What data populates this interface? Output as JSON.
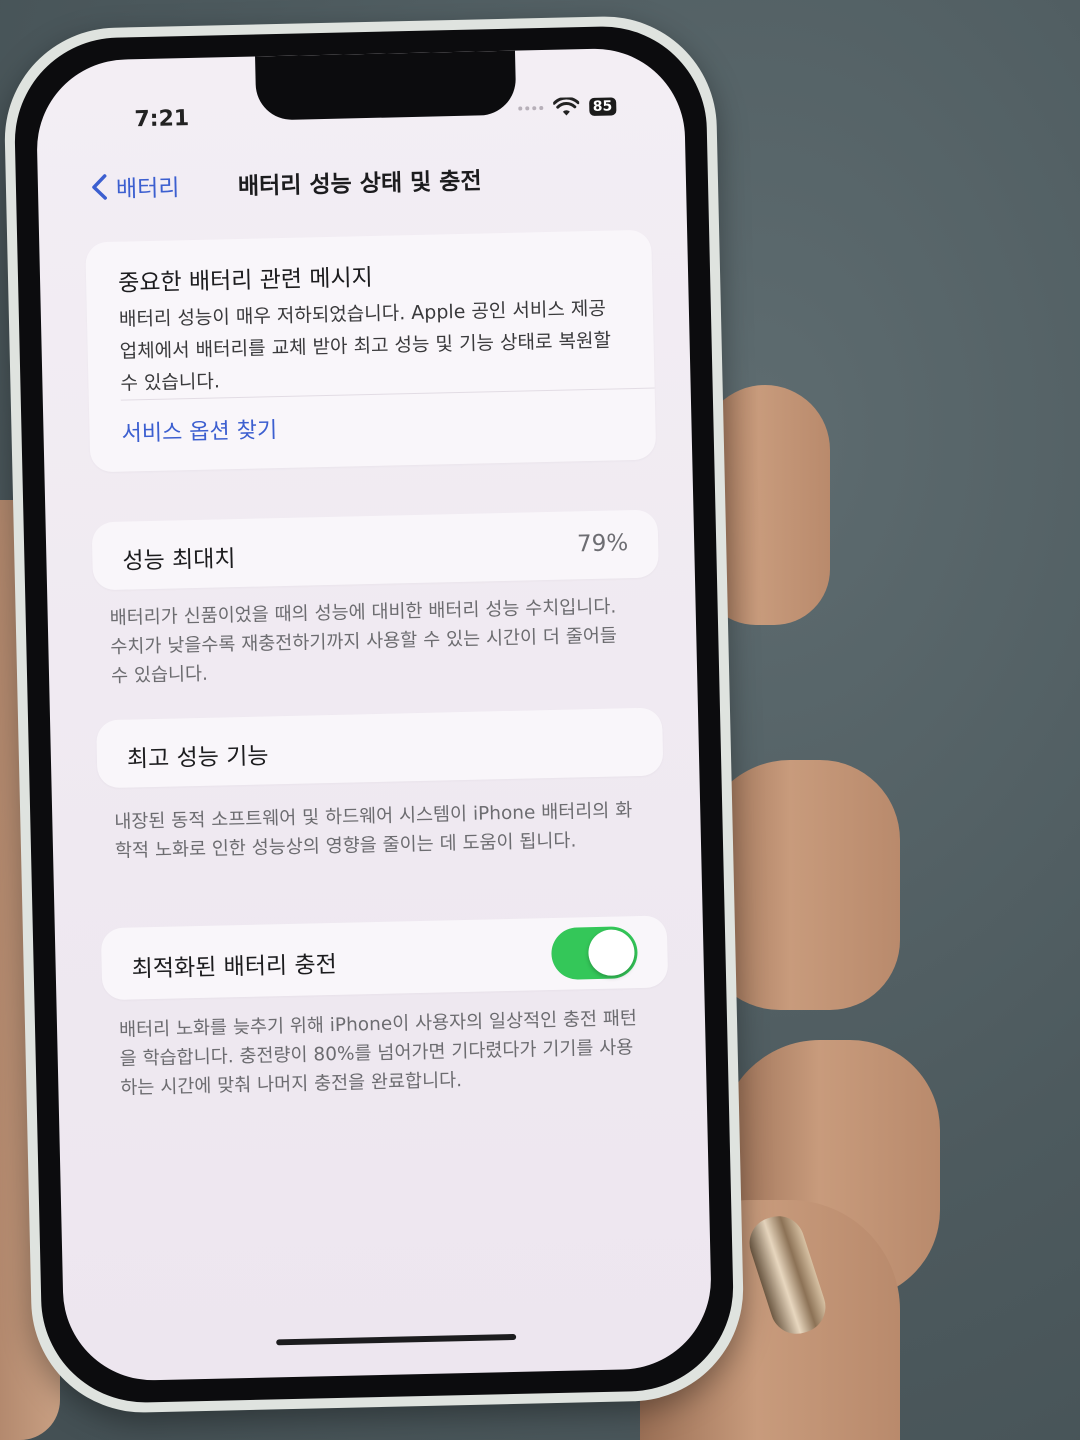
{
  "status_bar": {
    "time": "7:21",
    "battery_level": "85"
  },
  "nav": {
    "back_label": "배터리",
    "title": "배터리 성능 상태 및 충전"
  },
  "important_message": {
    "title": "중요한 배터리 관련 메시지",
    "body": "배터리 성능이 매우 저하되었습니다. Apple 공인 서비스 제공업체에서 배터리를 교체 받아 최고 성능 및 기능 상태로 복원할 수 있습니다.",
    "link": "서비스 옵션 찾기"
  },
  "maximum_capacity": {
    "label": "성능 최대치",
    "value": "79%",
    "footnote": "배터리가 신품이었을 때의 성능에 대비한 배터리 성능 수치입니다. 수치가 낮을수록 재충전하기까지 사용할 수 있는 시간이 더 줄어들 수 있습니다."
  },
  "peak_performance": {
    "label": "최고 성능 기능",
    "footnote": "내장된 동적 소프트웨어 및 하드웨어 시스템이 iPhone 배터리의 화학적 노화로 인한 성능상의 영향을 줄이는 데 도움이 됩니다."
  },
  "optimized_charging": {
    "label": "최적화된 배터리 충전",
    "enabled": true,
    "footnote": "배터리 노화를 늦추기 위해 iPhone이 사용자의 일상적인 충전 패턴을 학습합니다. 충전량이 80%를 넘어가면 기다렸다가 기기를 사용하는 시간에 맞춰 나머지 충전을 완료합니다."
  },
  "colors": {
    "accent": "#3c5fd0",
    "toggle_on": "#34c759"
  }
}
